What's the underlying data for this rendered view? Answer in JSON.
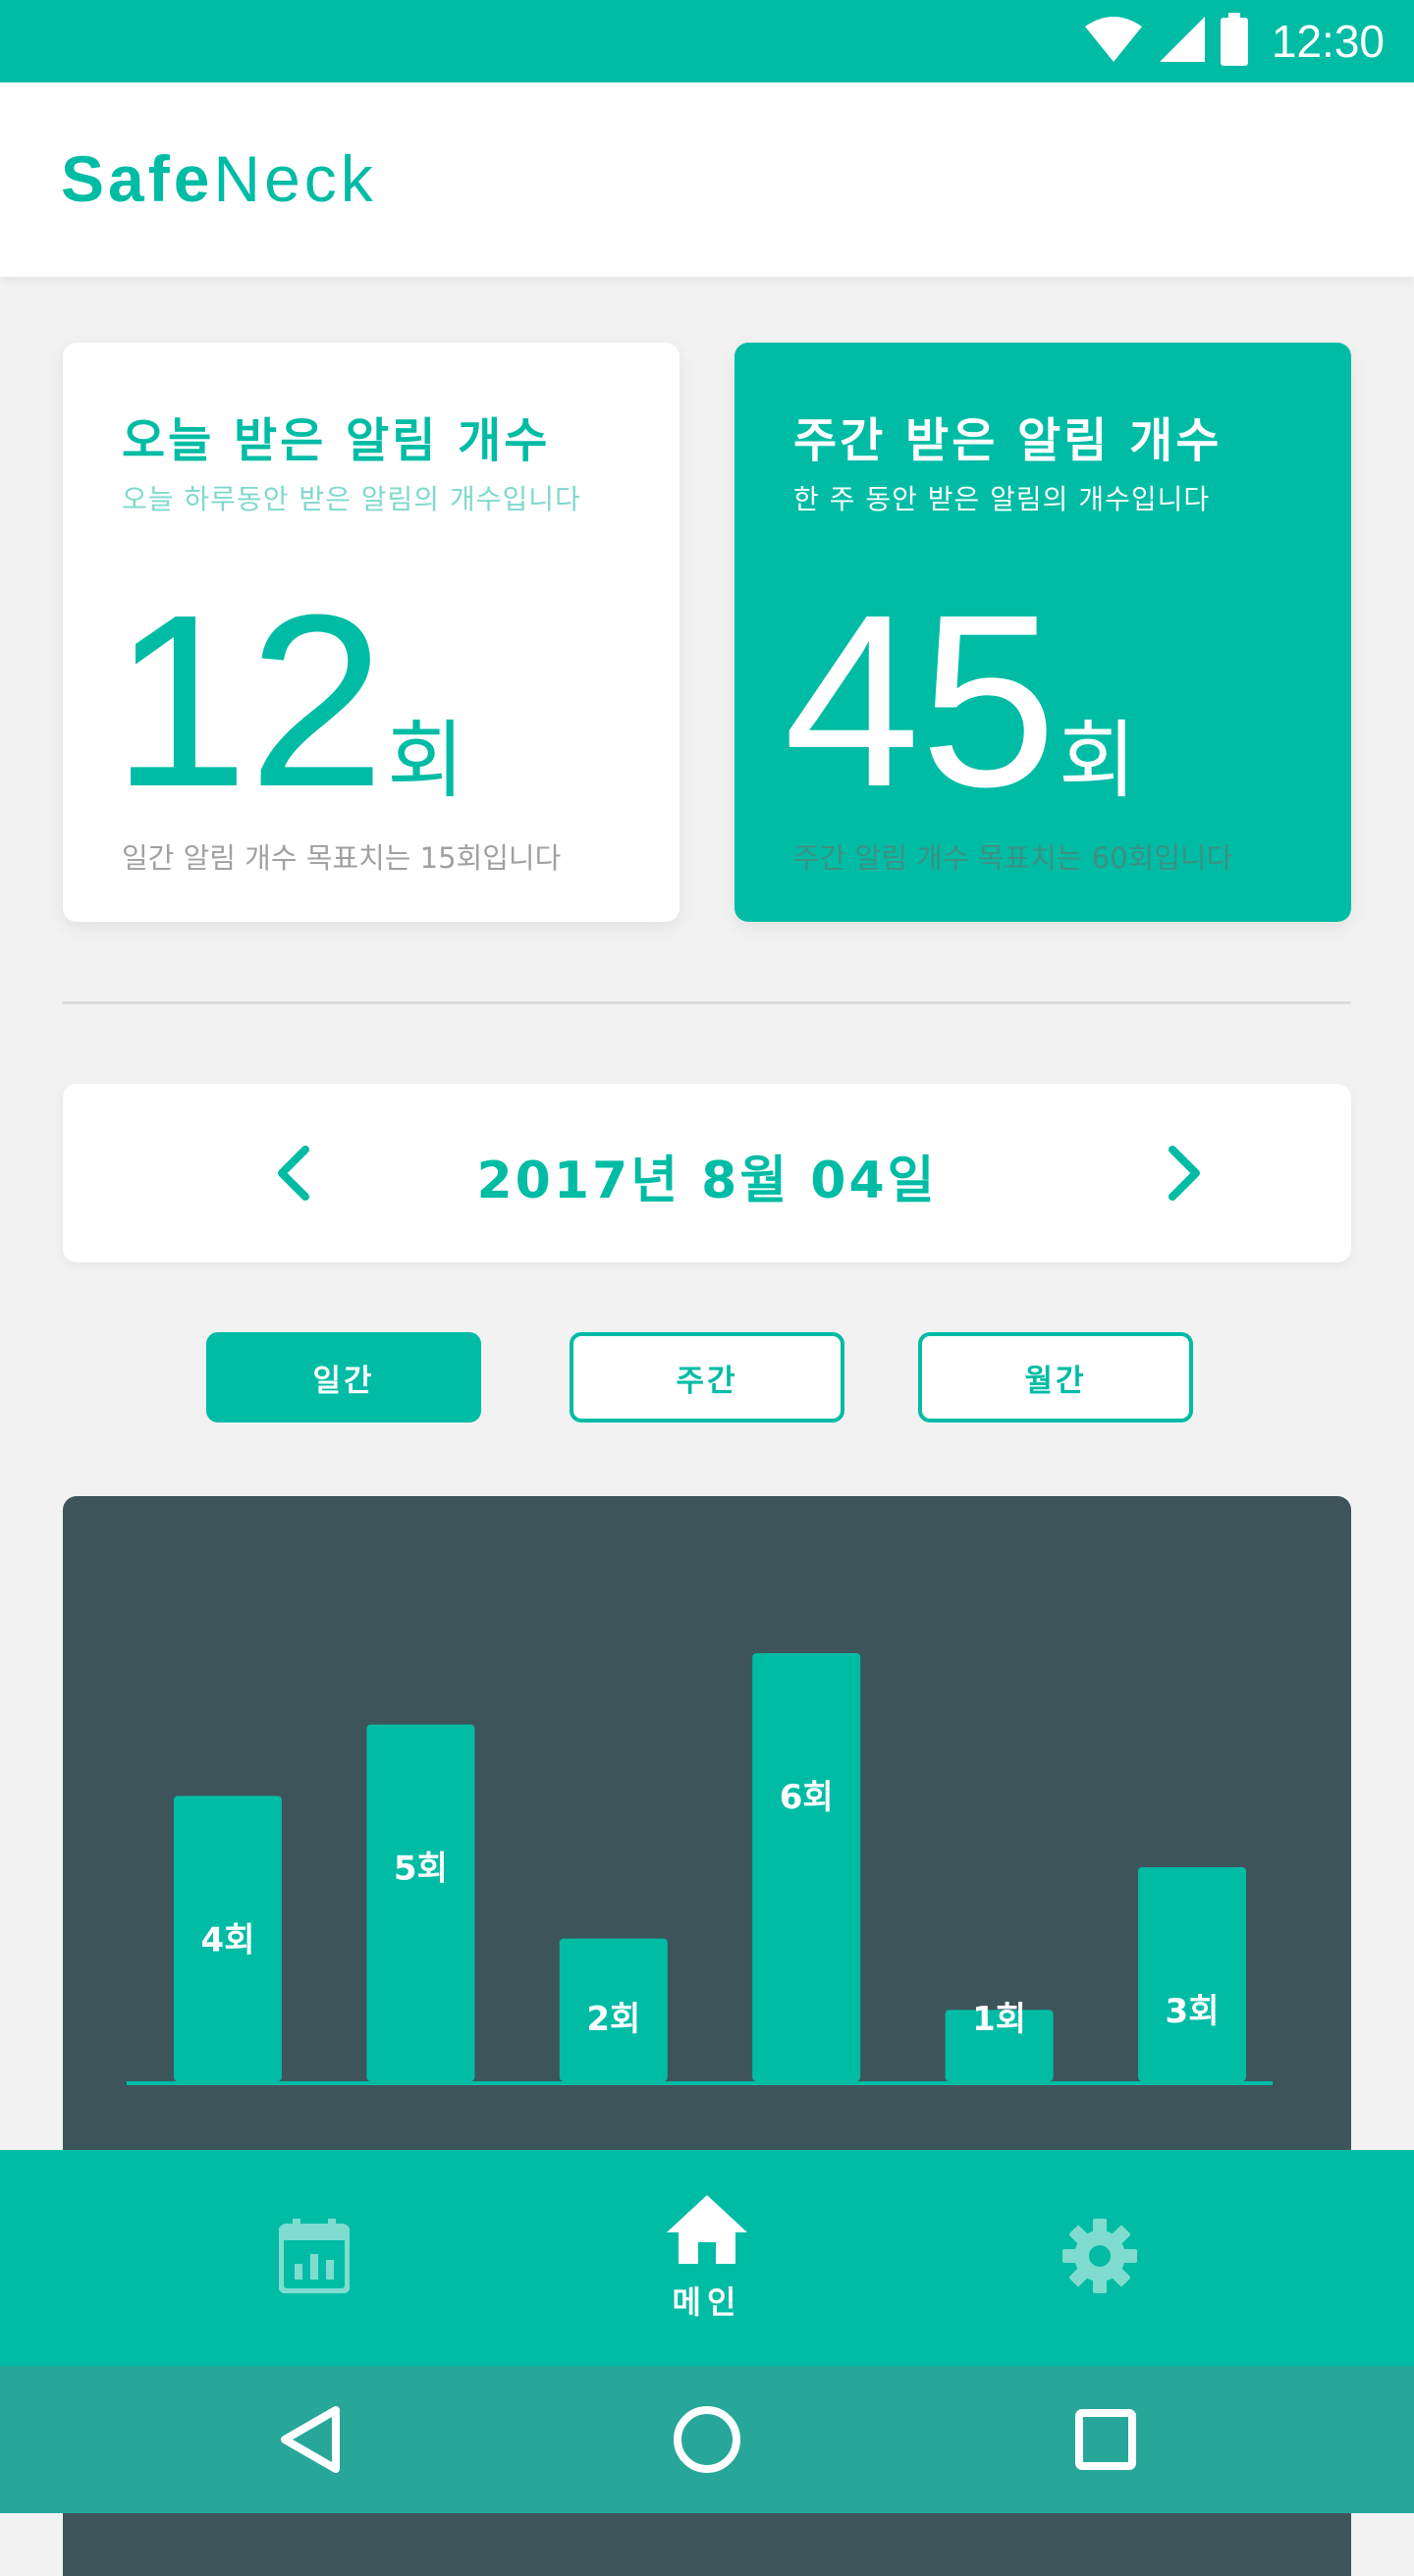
{
  "status_bar": {
    "time": "12:30",
    "icons": [
      "wifi-icon",
      "cell-signal-icon",
      "battery-icon"
    ]
  },
  "app": {
    "logo_bold": "Safe",
    "logo_light": "Neck"
  },
  "cards": {
    "daily": {
      "title": "오늘 받은 알림 개수",
      "subtitle": "오늘 하루동안 받은 알림의 개수입니다",
      "count": "12",
      "unit": "회",
      "footer": "일간 알림 개수 목표치는 15회입니다"
    },
    "weekly": {
      "title": "주간 받은 알림 개수",
      "subtitle": "한 주 동안 받은 알림의 개수입니다",
      "count": "45",
      "unit": "회",
      "footer": "주간 알림 개수 목표치는 60회입니다"
    }
  },
  "date_nav": {
    "date": "2017년 8월 04일",
    "prev_icon": "chevron-left-icon",
    "next_icon": "chevron-right-icon"
  },
  "tabs": [
    {
      "label": "일간",
      "active": true
    },
    {
      "label": "주간",
      "active": false
    },
    {
      "label": "월간",
      "active": false
    }
  ],
  "chart_data": {
    "type": "bar",
    "values": [
      4,
      5,
      2,
      6,
      1,
      3
    ],
    "labels": [
      "4회",
      "5회",
      "2회",
      "6회",
      "1회",
      "3회"
    ],
    "ylim": [
      0,
      6
    ],
    "grid": false
  },
  "bottom_nav": {
    "items": [
      {
        "icon": "calendar-chart-icon",
        "label": ""
      },
      {
        "icon": "home-icon",
        "label": "메인"
      },
      {
        "icon": "gear-icon",
        "label": ""
      }
    ]
  },
  "system_nav": {
    "icons": [
      "back-icon",
      "home-circle-icon",
      "recents-icon"
    ]
  },
  "colors": {
    "accent": "#00bca5",
    "chart_bg": "#3e545b",
    "sys_nav": "#27a799"
  }
}
